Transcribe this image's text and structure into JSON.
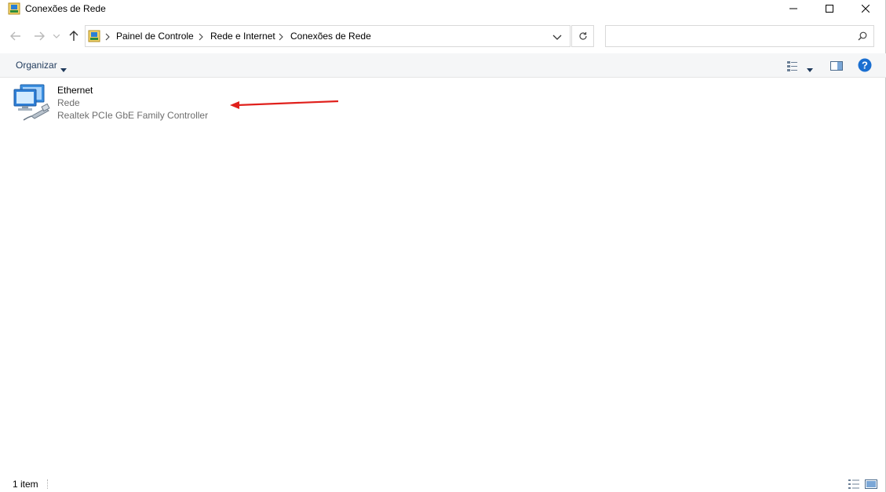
{
  "window": {
    "title": "Conexões de Rede"
  },
  "breadcrumb": {
    "items": [
      "Painel de Controle",
      "Rede e Internet",
      "Conexões de Rede"
    ]
  },
  "search": {
    "placeholder": ""
  },
  "toolbar": {
    "organize_label": "Organizar"
  },
  "items": [
    {
      "name": "Ethernet",
      "status": "Rede",
      "device": "Realtek PCIe GbE Family Controller",
      "icon": "network-adapter-icon"
    }
  ],
  "statusbar": {
    "count_label": "1 item"
  },
  "colors": {
    "annotation_arrow": "#e0201c",
    "command_text": "#1e395b",
    "help_icon": "#1a6fd1"
  }
}
